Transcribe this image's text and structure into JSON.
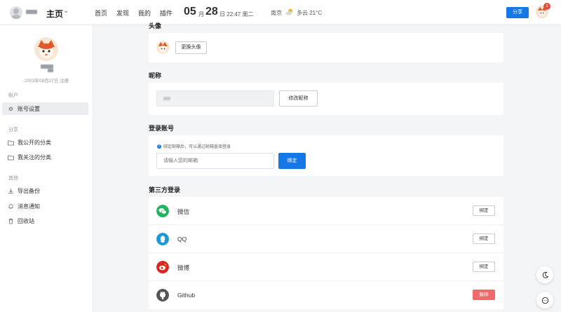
{
  "header": {
    "home_label": "主页",
    "nav": [
      "首页",
      "发现",
      "我的",
      "插件"
    ],
    "date_month": "05",
    "date_month_unit": "月",
    "date_day": "28",
    "date_rest": "日 22:47 周二",
    "weather_city": "南京",
    "weather_text": "多云 21°C",
    "share_label": "分享",
    "notification_count": "1",
    "accent_color": "#1677e6"
  },
  "sidebar": {
    "register_text": "2023年08月27日 注册",
    "sections": [
      {
        "label": "账户",
        "items": [
          {
            "label": "账号设置",
            "icon": "gear-icon",
            "active": true
          }
        ]
      },
      {
        "label": "分享",
        "items": [
          {
            "label": "我公开的分类",
            "icon": "folder-icon"
          },
          {
            "label": "我关注的分类",
            "icon": "folder-icon"
          }
        ]
      },
      {
        "label": "其他",
        "items": [
          {
            "label": "导出备份",
            "icon": "download-icon"
          },
          {
            "label": "消息通知",
            "icon": "bell-icon"
          },
          {
            "label": "回收站",
            "icon": "trash-icon"
          }
        ]
      }
    ]
  },
  "main": {
    "avatar_section_title": "头像",
    "change_avatar_label": "更换头像",
    "nickname_section_title": "昵称",
    "change_nickname_label": "修改昵称",
    "login_section_title": "登录账号",
    "login_hint": "绑定邮箱后，可以通过邮箱直接登录",
    "email_placeholder": "请输入您的邮箱",
    "bind_label": "绑定",
    "third_party_title": "第三方登录",
    "third_party": [
      {
        "name": "微信",
        "action": "绑定",
        "icon": "wechat-icon",
        "color": "#22b35e"
      },
      {
        "name": "QQ",
        "action": "绑定",
        "icon": "qq-icon",
        "color": "#1a9ad9"
      },
      {
        "name": "微博",
        "action": "绑定",
        "icon": "weibo-icon",
        "color": "#d9281f"
      },
      {
        "name": "Github",
        "action": "解绑",
        "icon": "github-icon",
        "color": "#555555"
      }
    ]
  }
}
